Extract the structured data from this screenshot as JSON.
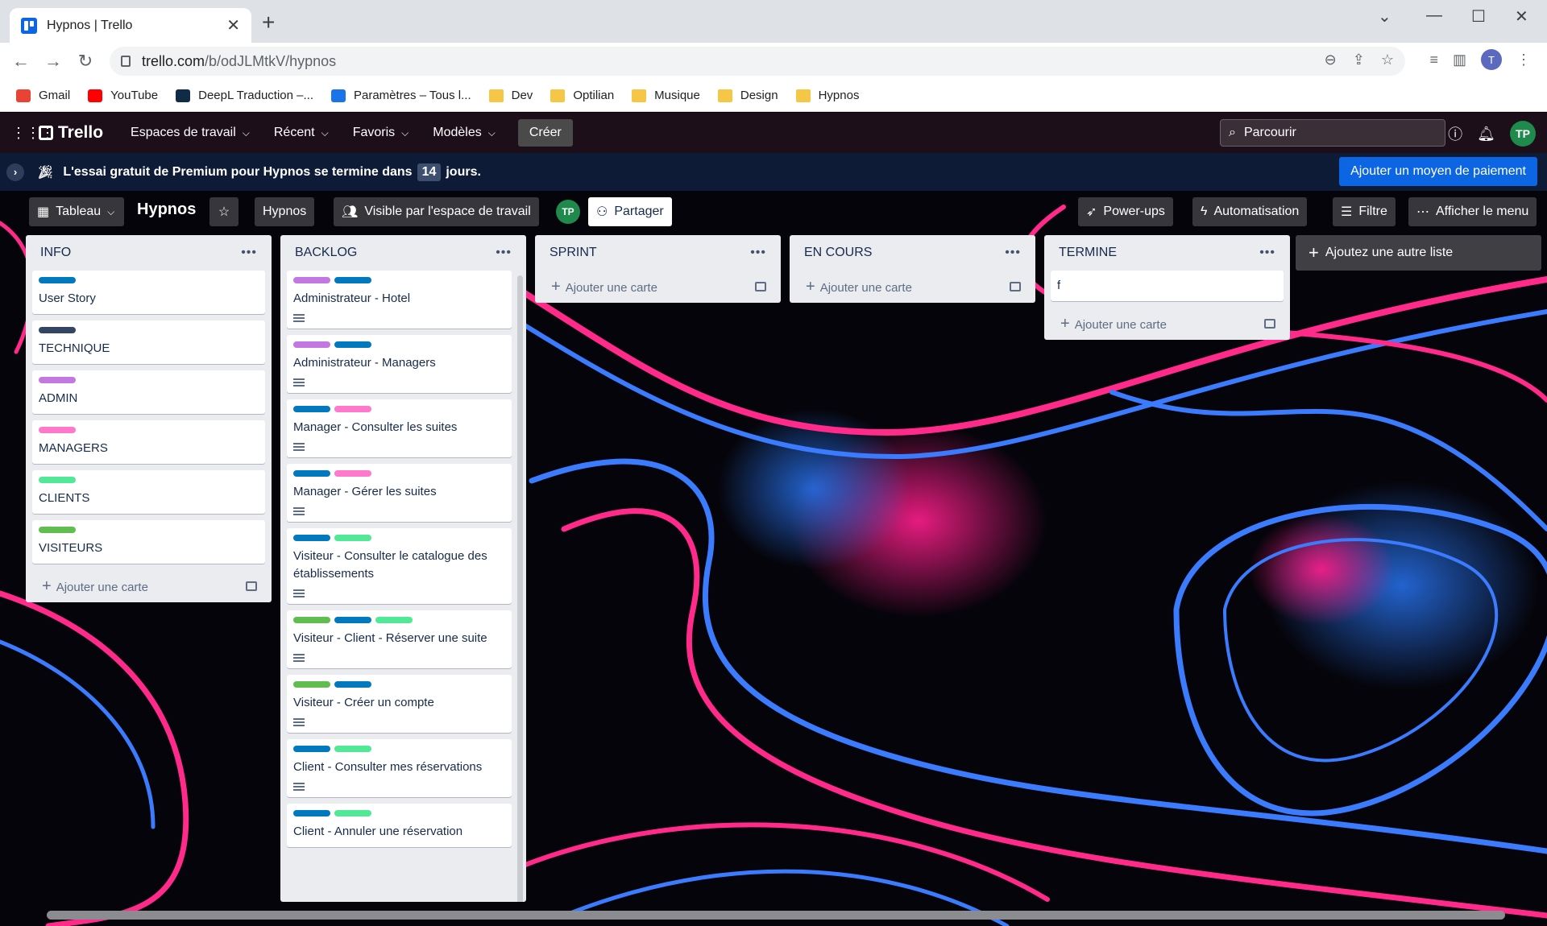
{
  "browser": {
    "tab_title": "Hypnos | Trello",
    "url_host": "trello.com",
    "url_path": "/b/odJLMtkV/hypnos",
    "profile_initial": "T",
    "bookmarks": [
      {
        "label": "Gmail",
        "icon": "gmail-icon",
        "color": "#ea4335"
      },
      {
        "label": "YouTube",
        "icon": "youtube-icon",
        "color": "#ff0000"
      },
      {
        "label": "DeepL Traduction –...",
        "icon": "deepl-icon",
        "color": "#0f2b46"
      },
      {
        "label": "Paramètres – Tous l...",
        "icon": "settings-gear-icon",
        "color": "#1a73e8"
      },
      {
        "label": "Dev",
        "icon": "folder-icon",
        "color": "#f6c647"
      },
      {
        "label": "Optilian",
        "icon": "folder-icon",
        "color": "#f6c647"
      },
      {
        "label": "Musique",
        "icon": "folder-icon",
        "color": "#f6c647"
      },
      {
        "label": "Design",
        "icon": "folder-icon",
        "color": "#f6c647"
      },
      {
        "label": "Hypnos",
        "icon": "folder-icon",
        "color": "#f6c647"
      }
    ]
  },
  "header": {
    "logo": "Trello",
    "nav": [
      "Espaces de travail",
      "Récent",
      "Favoris",
      "Modèles"
    ],
    "create": "Créer",
    "search_placeholder": "Parcourir",
    "avatar": "TP"
  },
  "banner": {
    "text_before": "L'essai gratuit de Premium pour Hypnos se termine dans",
    "days": "14",
    "text_after": "jours.",
    "cta": "Ajouter un moyen de paiement"
  },
  "board": {
    "view": "Tableau",
    "title": "Hypnos",
    "workspace": "Hypnos",
    "visibility": "Visible par l'espace de travail",
    "member_avatar": "TP",
    "share": "Partager",
    "powerups": "Power-ups",
    "automation": "Automatisation",
    "filter": "Filtre",
    "menu": "Afficher le menu",
    "add_list": "Ajoutez une autre liste",
    "add_card": "Ajouter une carte"
  },
  "colors": {
    "blue": "#0079bf",
    "navy": "#344563",
    "purple": "#c377e0",
    "pink": "#ff78cb",
    "green": "#51e898",
    "lime": "#61bd4f"
  },
  "lists": [
    {
      "title": "INFO",
      "cards": [
        {
          "title": "User Story",
          "labels": [
            "blue"
          ],
          "desc": false
        },
        {
          "title": "TECHNIQUE",
          "labels": [
            "navy"
          ],
          "desc": false
        },
        {
          "title": "ADMIN",
          "labels": [
            "purple"
          ],
          "desc": false
        },
        {
          "title": "MANAGERS",
          "labels": [
            "pink"
          ],
          "desc": false
        },
        {
          "title": "CLIENTS",
          "labels": [
            "green"
          ],
          "desc": false
        },
        {
          "title": "VISITEURS",
          "labels": [
            "lime"
          ],
          "desc": false
        }
      ]
    },
    {
      "title": "BACKLOG",
      "cards": [
        {
          "title": "Administrateur - Hotel",
          "labels": [
            "purple",
            "blue"
          ],
          "desc": true
        },
        {
          "title": "Administrateur - Managers",
          "labels": [
            "purple",
            "blue"
          ],
          "desc": true
        },
        {
          "title": "Manager - Consulter les suites",
          "labels": [
            "blue",
            "pink"
          ],
          "desc": true
        },
        {
          "title": "Manager - Gérer les suites",
          "labels": [
            "blue",
            "pink"
          ],
          "desc": true
        },
        {
          "title": "Visiteur - Consulter le catalogue des établissements",
          "labels": [
            "blue",
            "green"
          ],
          "desc": true
        },
        {
          "title": "Visiteur - Client - Réserver une suite",
          "labels": [
            "lime",
            "blue",
            "green"
          ],
          "desc": true
        },
        {
          "title": "Visiteur - Créer un compte",
          "labels": [
            "lime",
            "blue"
          ],
          "desc": true
        },
        {
          "title": "Client - Consulter mes réservations",
          "labels": [
            "blue",
            "green"
          ],
          "desc": true
        },
        {
          "title": "Client - Annuler une réservation",
          "labels": [
            "blue",
            "green"
          ],
          "desc": false
        }
      ]
    },
    {
      "title": "SPRINT",
      "cards": []
    },
    {
      "title": "EN COURS",
      "cards": []
    },
    {
      "title": "TERMINE",
      "cards": [
        {
          "title": "f",
          "labels": [],
          "desc": false
        }
      ]
    }
  ]
}
